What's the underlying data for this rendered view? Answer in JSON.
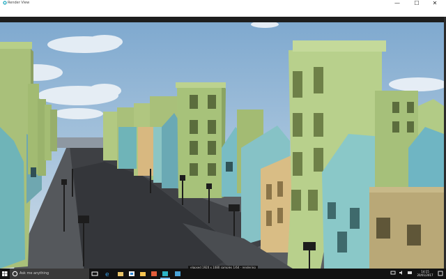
{
  "window": {
    "title": "Render View",
    "minimize_glyph": "—",
    "maximize_glyph": "☐",
    "close_glyph": "✕",
    "app_icon": "app-logo-icon"
  },
  "viewport": {
    "description_icon": "3d-scene",
    "status": "elapsed 1920 x 1080 samples 1/64 - rendering"
  },
  "taskbar": {
    "start_icon": "windows-logo-icon",
    "search_placeholder": "Ask me anything",
    "pinned": [
      "task-view-icon",
      "edge-icon",
      "explorer-icon",
      "store-icon",
      "folder-icon",
      "photos-icon",
      "app-icon",
      "app-icon"
    ],
    "tray": [
      "network-icon",
      "volume-icon",
      "keyboard-icon"
    ],
    "time": "14:15",
    "date": "20/01/2017",
    "accent": "#76b9ed"
  }
}
